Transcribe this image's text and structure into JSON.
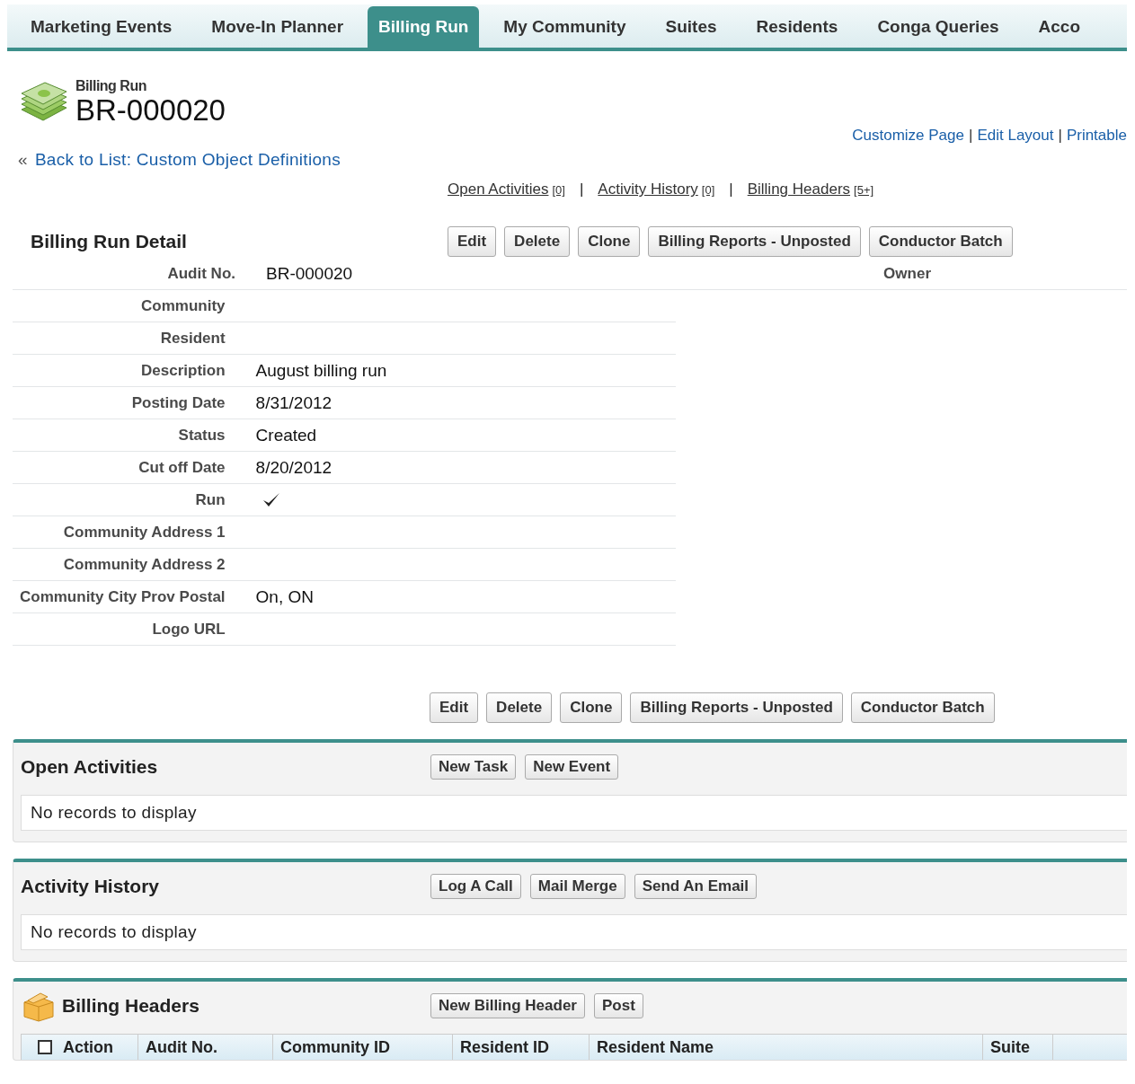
{
  "tabs": [
    {
      "label": "Marketing Events",
      "selected": false
    },
    {
      "label": "Move-In Planner",
      "selected": false
    },
    {
      "label": "Billing Run",
      "selected": true
    },
    {
      "label": "My Community",
      "selected": false
    },
    {
      "label": "Suites",
      "selected": false
    },
    {
      "label": "Residents",
      "selected": false
    },
    {
      "label": "Conga Queries",
      "selected": false
    },
    {
      "label": "Acco",
      "selected": false
    }
  ],
  "record": {
    "type_label": "Billing Run",
    "name": "BR-000020"
  },
  "top_links": [
    {
      "label": "Customize Page"
    },
    {
      "separator": "|",
      "label": "Edit Layout"
    },
    {
      "separator": "|",
      "label": "Printable"
    }
  ],
  "back_link": {
    "prefix": "«",
    "label": "Back to List: Custom Object Definitions"
  },
  "related_links": [
    {
      "label": "Open Activities",
      "count": "[0]"
    },
    {
      "separator": "|",
      "label": "Activity History",
      "count": "[0]"
    },
    {
      "separator": "|",
      "label": "Billing Headers",
      "count": "[5+]"
    }
  ],
  "detail": {
    "title": "Billing Run Detail",
    "buttons": [
      "Edit",
      "Delete",
      "Clone",
      "Billing Reports - Unposted",
      "Conductor Batch"
    ],
    "fields": [
      {
        "label": "Audit No.",
        "kind": "text",
        "value": "BR-000020"
      },
      {
        "label": "Community",
        "kind": "text"
      },
      {
        "label": "Resident",
        "kind": "text"
      },
      {
        "label": "Description",
        "kind": "text",
        "value": "August billing run"
      },
      {
        "label": "Posting Date",
        "kind": "text",
        "value": "8/31/2012"
      },
      {
        "label": "Status",
        "kind": "text",
        "value": "Created"
      },
      {
        "label": "Cut off Date",
        "kind": "text",
        "value": "8/20/2012"
      },
      {
        "label": "Run",
        "kind": "checkbox",
        "checked": true
      },
      {
        "label": "Community Address 1",
        "kind": "text"
      },
      {
        "label": "Community Address 2",
        "kind": "text"
      },
      {
        "label": "Community City Prov Postal",
        "kind": "text",
        "value": "On, ON"
      },
      {
        "label": "Logo URL",
        "kind": "text"
      }
    ],
    "right_fields": [
      {
        "label": "Owner"
      }
    ],
    "bottom_buttons": [
      "Edit",
      "Delete",
      "Clone",
      "Billing Reports - Unposted",
      "Conductor Batch"
    ]
  },
  "related_lists": [
    {
      "kind": "empty",
      "title": "Open Activities",
      "buttons": [
        "New Task",
        "New Event"
      ],
      "empty_text": "No records to display"
    },
    {
      "kind": "empty",
      "title": "Activity History",
      "buttons": [
        "Log A Call",
        "Mail Merge",
        "Send An Email"
      ],
      "empty_text": "No records to display"
    },
    {
      "kind": "table",
      "title": "Billing Headers",
      "buttons": [
        "New Billing Header",
        "Post"
      ],
      "select_all": {
        "checked": false
      },
      "columns": [
        "Action",
        "Audit No.",
        "Community ID",
        "Resident ID",
        "Resident Name",
        "Suite"
      ]
    }
  ]
}
